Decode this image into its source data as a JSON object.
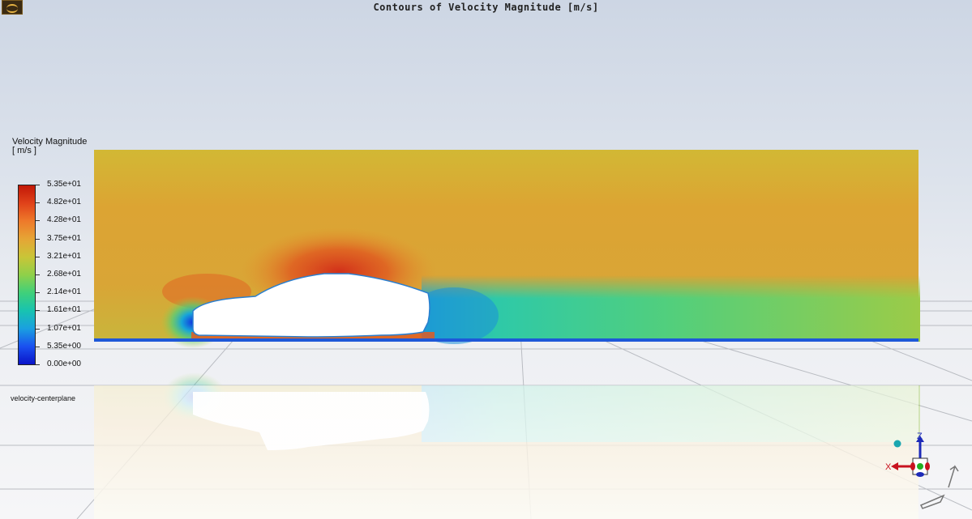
{
  "window": {
    "title": "Contours of Velocity Magnitude [m/s]"
  },
  "legend": {
    "title_line1": "Velocity Magnitude",
    "title_line2": "[ m/s ]",
    "labels": [
      "5.35e+01",
      "4.82e+01",
      "4.28e+01",
      "3.75e+01",
      "3.21e+01",
      "2.68e+01",
      "2.14e+01",
      "1.61e+01",
      "1.07e+01",
      "5.35e+00",
      "0.00e+00"
    ],
    "colors": [
      "#c21807",
      "#e0421a",
      "#ee7a2a",
      "#e6a535",
      "#c9c537",
      "#8fd04a",
      "#3fd07a",
      "#18c3b0",
      "#1aa0e0",
      "#1a50f0",
      "#0a14c8"
    ]
  },
  "surface": {
    "name": "velocity-centerplane"
  },
  "axes": {
    "x_label": "X",
    "z_label": "Z"
  }
}
